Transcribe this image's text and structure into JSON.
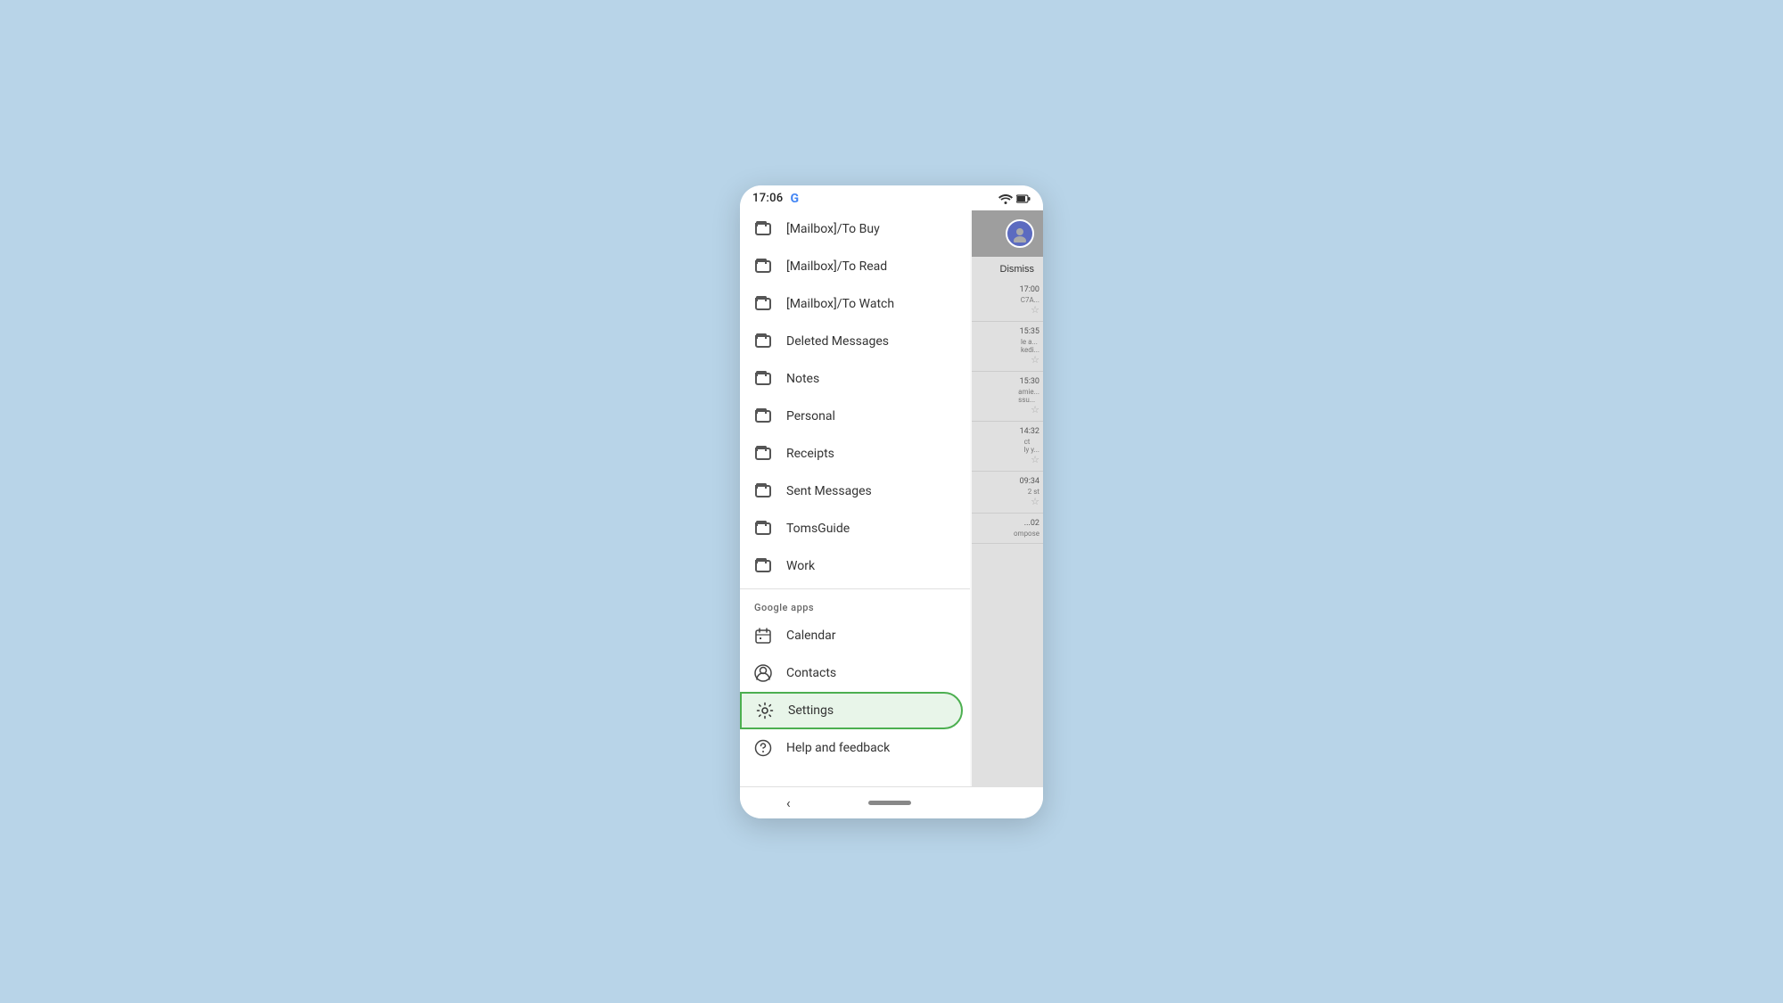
{
  "status_bar": {
    "time": "17:06",
    "google_logo": "G"
  },
  "drawer": {
    "menu_items": [
      {
        "id": "mailbox-to-buy",
        "label": "[Mailbox]/To Buy",
        "icon": "folder"
      },
      {
        "id": "mailbox-to-read",
        "label": "[Mailbox]/To Read",
        "icon": "folder"
      },
      {
        "id": "mailbox-to-watch",
        "label": "[Mailbox]/To Watch",
        "icon": "folder"
      },
      {
        "id": "deleted-messages",
        "label": "Deleted Messages",
        "icon": "folder"
      },
      {
        "id": "notes",
        "label": "Notes",
        "icon": "folder"
      },
      {
        "id": "personal",
        "label": "Personal",
        "icon": "folder"
      },
      {
        "id": "receipts",
        "label": "Receipts",
        "icon": "folder"
      },
      {
        "id": "sent-messages",
        "label": "Sent Messages",
        "icon": "folder"
      },
      {
        "id": "tomsguide",
        "label": "TomsGuide",
        "icon": "folder"
      },
      {
        "id": "work",
        "label": "Work",
        "icon": "folder"
      }
    ],
    "google_apps_section": "Google apps",
    "google_apps": [
      {
        "id": "calendar",
        "label": "Calendar",
        "icon": "calendar"
      },
      {
        "id": "contacts",
        "label": "Contacts",
        "icon": "contacts"
      },
      {
        "id": "settings",
        "label": "Settings",
        "icon": "settings",
        "active": true
      },
      {
        "id": "help-feedback",
        "label": "Help and feedback",
        "icon": "help"
      }
    ]
  },
  "email_list": {
    "dismiss_label": "Dismiss",
    "items": [
      {
        "time": "17:00",
        "snippet": "C7A...",
        "has_star": true
      },
      {
        "time": "15:35",
        "snippet": "le a...\nkedi...",
        "has_star": true
      },
      {
        "time": "15:30",
        "snippet": "amie...\nssu...",
        "has_star": true
      },
      {
        "time": "14:32",
        "snippet": "ct\nly y...",
        "has_star": true
      },
      {
        "time": "09:34",
        "snippet": "2 st",
        "has_star": true
      },
      {
        "time": "...02",
        "snippet": "ompose",
        "has_star": false
      }
    ]
  },
  "bottom_nav": {
    "back_icon": "‹"
  },
  "colors": {
    "active_border": "#4CAF50",
    "active_bg": "#e8f5e9",
    "accent_blue": "#4285F4"
  }
}
